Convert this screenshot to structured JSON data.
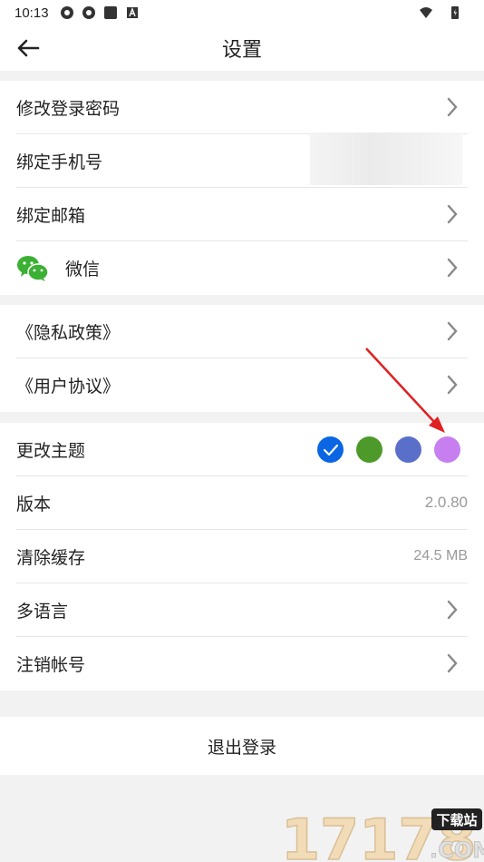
{
  "status_bar": {
    "time": "10:13",
    "icons": [
      "gear-icon",
      "gear-icon",
      "square-icon",
      "app-a-icon"
    ],
    "right_icons": [
      "wifi-icon",
      "battery-icon"
    ]
  },
  "header": {
    "title": "设置",
    "back_icon": "arrow-left-icon"
  },
  "account_group": {
    "items": [
      {
        "label": "修改登录密码",
        "icon": "chevron-right-icon"
      },
      {
        "label": "绑定手机号"
      },
      {
        "label": "绑定邮箱",
        "icon": "chevron-right-icon"
      },
      {
        "label": "微信",
        "leading_icon": "wechat-icon",
        "icon": "chevron-right-icon"
      }
    ]
  },
  "policy_group": {
    "items": [
      {
        "label": "《隐私政策》",
        "icon": "chevron-right-icon"
      },
      {
        "label": "《用户协议》",
        "icon": "chevron-right-icon"
      }
    ]
  },
  "settings_group": {
    "theme": {
      "label": "更改主题",
      "colors": [
        "#0b66e4",
        "#4d9a2a",
        "#5a6fc9",
        "#c77ff0"
      ],
      "selected": 0
    },
    "version": {
      "label": "版本",
      "value": "2.0.80"
    },
    "cache": {
      "label": "清除缓存",
      "value": "24.5 MB"
    },
    "language": {
      "label": "多语言",
      "icon": "chevron-right-icon"
    },
    "cancel_account": {
      "label": "注销帐号",
      "icon": "chevron-right-icon"
    }
  },
  "logout": {
    "label": "退出登录"
  },
  "watermark": {
    "text": "17178",
    "badge": "下载站",
    "suffix": ".COM"
  },
  "colors": {
    "divider": "#e6e6e6",
    "background": "#f2f2f2",
    "annotation_arrow": "#e02020"
  }
}
